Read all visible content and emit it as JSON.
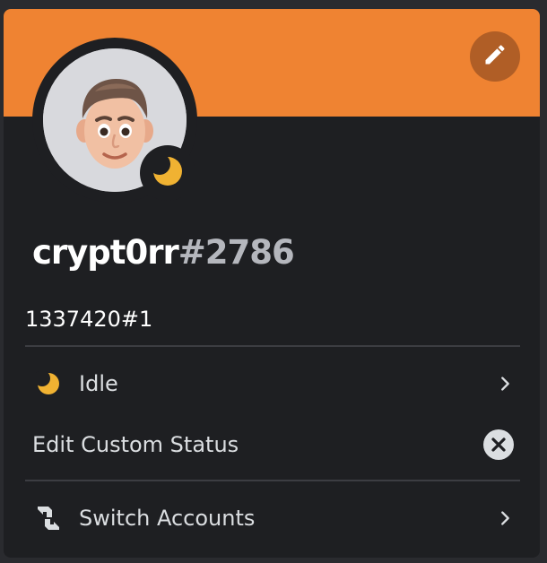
{
  "colors": {
    "banner": "#ef8332",
    "edit_button": "#b05e26",
    "idle": "#f0b232",
    "background": "#1e1f22",
    "text_muted": "#b5b7bd"
  },
  "profile": {
    "username": "crypt0rr",
    "discriminator": "#2786",
    "custom_line": "1337420#1",
    "avatar_icon": "memoji-avatar",
    "status_icon": "idle-moon-icon"
  },
  "banner": {
    "edit_icon": "pencil-icon"
  },
  "menu": {
    "status": {
      "label": "Idle",
      "icon": "idle-moon-icon",
      "trail_icon": "chevron-right-icon"
    },
    "custom_status": {
      "label": "Edit Custom Status",
      "trail_icon": "clear-circle-x-icon"
    },
    "switch_accounts": {
      "label": "Switch Accounts",
      "icon": "switch-accounts-icon",
      "trail_icon": "chevron-right-icon"
    }
  }
}
